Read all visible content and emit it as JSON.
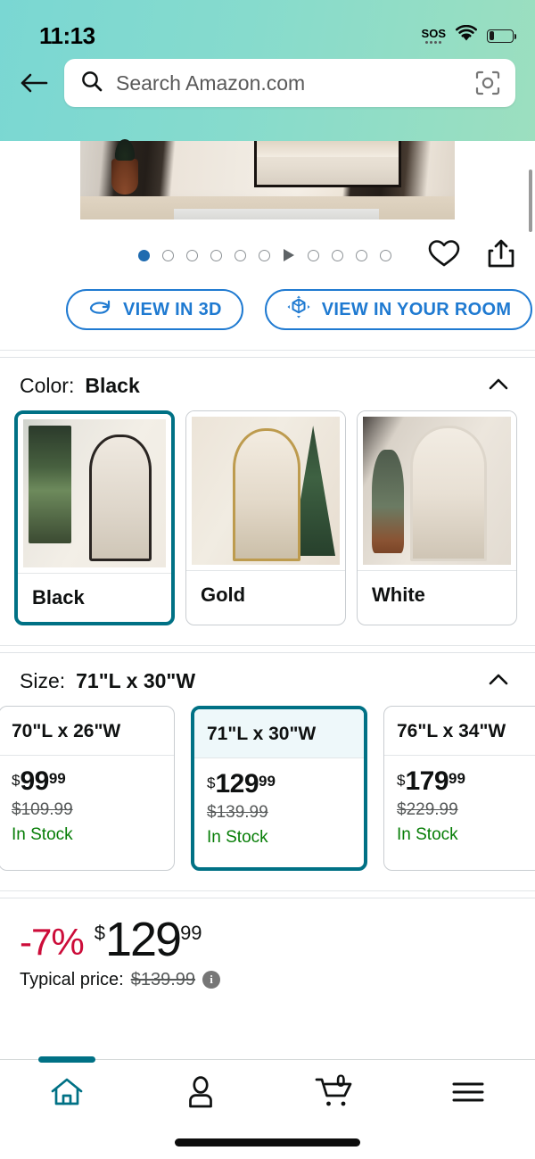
{
  "status_bar": {
    "time": "11:13",
    "sos_label": "SOS",
    "wifi_icon": "wifi-icon",
    "battery_icon": "battery-icon"
  },
  "header": {
    "back_icon": "back-arrow-icon",
    "search": {
      "placeholder": "Search Amazon.com",
      "search_icon": "search-icon",
      "camera_icon": "camera-scan-icon"
    },
    "gradient_start": "#7ad7d3",
    "gradient_end": "#9cdfbf"
  },
  "gallery": {
    "total_dots": 10,
    "active_index": 0,
    "video_marker_after_index": 5,
    "active_dot_color": "#1f6bb0",
    "wishlist_icon": "heart-icon",
    "share_icon": "share-icon",
    "buttons": [
      {
        "label": "VIEW IN 3D",
        "icon": "rotate-3d-icon"
      },
      {
        "label": "VIEW IN YOUR ROOM",
        "icon": "ar-cube-icon"
      }
    ]
  },
  "color_section": {
    "label": "Color:",
    "selected": "Black",
    "collapse_icon": "chevron-up-icon",
    "options": [
      {
        "name": "Black",
        "selected": true,
        "scene": "sc-black"
      },
      {
        "name": "Gold",
        "selected": false,
        "scene": "sc-gold"
      },
      {
        "name": "White",
        "selected": false,
        "scene": "sc-white"
      }
    ]
  },
  "size_section": {
    "label": "Size:",
    "selected": "71\"L x 30\"W",
    "collapse_icon": "chevron-up-icon",
    "stock_label": "In Stock",
    "stock_color": "#067d06",
    "options": [
      {
        "size": "70\"L x 26\"W",
        "currency": "$",
        "price_whole": "99",
        "price_fraction": "99",
        "list_price": "$109.99",
        "availability": "In Stock",
        "selected": false
      },
      {
        "size": "71\"L x 30\"W",
        "currency": "$",
        "price_whole": "129",
        "price_fraction": "99",
        "list_price": "$139.99",
        "availability": "In Stock",
        "selected": true
      },
      {
        "size": "76\"L x 34\"W",
        "currency": "$",
        "price_whole": "179",
        "price_fraction": "99",
        "list_price": "$229.99",
        "availability": "In Stock",
        "selected": false
      }
    ]
  },
  "price_block": {
    "discount": "-7%",
    "discount_color": "#cc0c39",
    "currency": "$",
    "price_whole": "129",
    "price_fraction": "99",
    "typical_label": "Typical price:",
    "typical_value": "$139.99",
    "info_icon": "info-icon",
    "info_glyph": "i"
  },
  "bottom_nav": {
    "accent_color": "#007185",
    "items": [
      {
        "name": "home",
        "icon": "home-icon",
        "active": true
      },
      {
        "name": "account",
        "icon": "person-icon",
        "active": false
      },
      {
        "name": "cart",
        "icon": "cart-icon",
        "active": false,
        "badge": "0"
      },
      {
        "name": "menu",
        "icon": "hamburger-menu-icon",
        "active": false
      }
    ]
  }
}
